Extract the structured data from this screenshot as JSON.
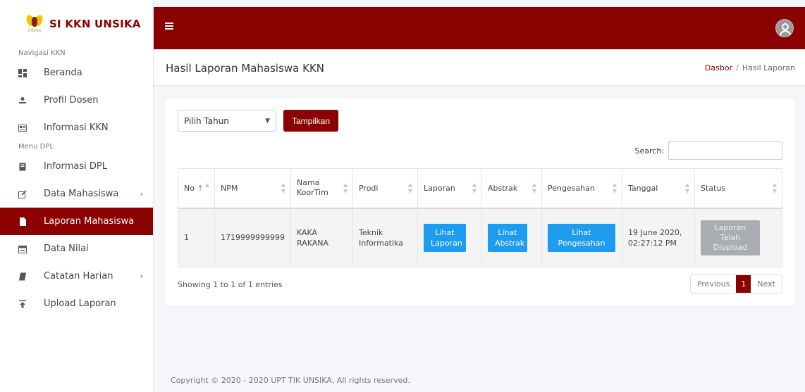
{
  "brand": {
    "title": "SI KKN UNSIKA",
    "logo_text": "UNSIKA"
  },
  "sidebar": {
    "section_nav": "Navigasi KKN",
    "section_menu": "Menu DPL",
    "items": [
      {
        "label": "Beranda",
        "icon": "dashboard-icon"
      },
      {
        "label": "Profil Dosen",
        "icon": "user-icon"
      },
      {
        "label": "Informasi KKN",
        "icon": "newspaper-icon"
      },
      {
        "label": "Informasi DPL",
        "icon": "book-icon"
      },
      {
        "label": "Data Mahasiswa",
        "icon": "edit-icon",
        "caret": "›"
      },
      {
        "label": "Laporan Mahasiswa",
        "icon": "file-icon",
        "active": true
      },
      {
        "label": "Data Nilai",
        "icon": "calendar-icon"
      },
      {
        "label": "Catatan Harian",
        "icon": "journal-icon",
        "caret": "›"
      },
      {
        "label": "Upload Laporan",
        "icon": "upload-icon"
      }
    ]
  },
  "header": {
    "page_title": "Hasil Laporan Mahasiswa KKN",
    "breadcrumb": {
      "home": "Dasbor",
      "separator": "/",
      "current": "Hasil Laporan"
    }
  },
  "filter": {
    "select_value": "Pilih Tahun",
    "button_label": "Tampilkan"
  },
  "search": {
    "label": "Search:"
  },
  "table": {
    "columns": [
      "No",
      "NPM",
      "Nama KoorTim",
      "Prodi",
      "Laporan",
      "Abstrak",
      "Pengesahan",
      "Tanggal",
      "Status"
    ],
    "rows": [
      {
        "no": "1",
        "npm": "1719999999999",
        "nama": "KAKA RAKANA",
        "prodi": "Teknik Informatika",
        "laporan": "Lihat Laporan",
        "abstrak": "Lihat Abstrak",
        "pengesahan": "Lihat Pengesahan",
        "tanggal": "19 June 2020, 02:27:12 PM",
        "status": "Laporan Telah Diupload"
      }
    ]
  },
  "pagination": {
    "info": "Showing 1 to 1 of 1 entries",
    "previous": "Previous",
    "current": "1",
    "next": "Next"
  },
  "footer": {
    "text": "Copyright © 2020 - 2020 UPT TIK UNSIKA, All rights reserved."
  },
  "colors": {
    "primary": "#8b0000",
    "button_blue": "#1e9cf0",
    "status_gray": "#a9adb2"
  }
}
